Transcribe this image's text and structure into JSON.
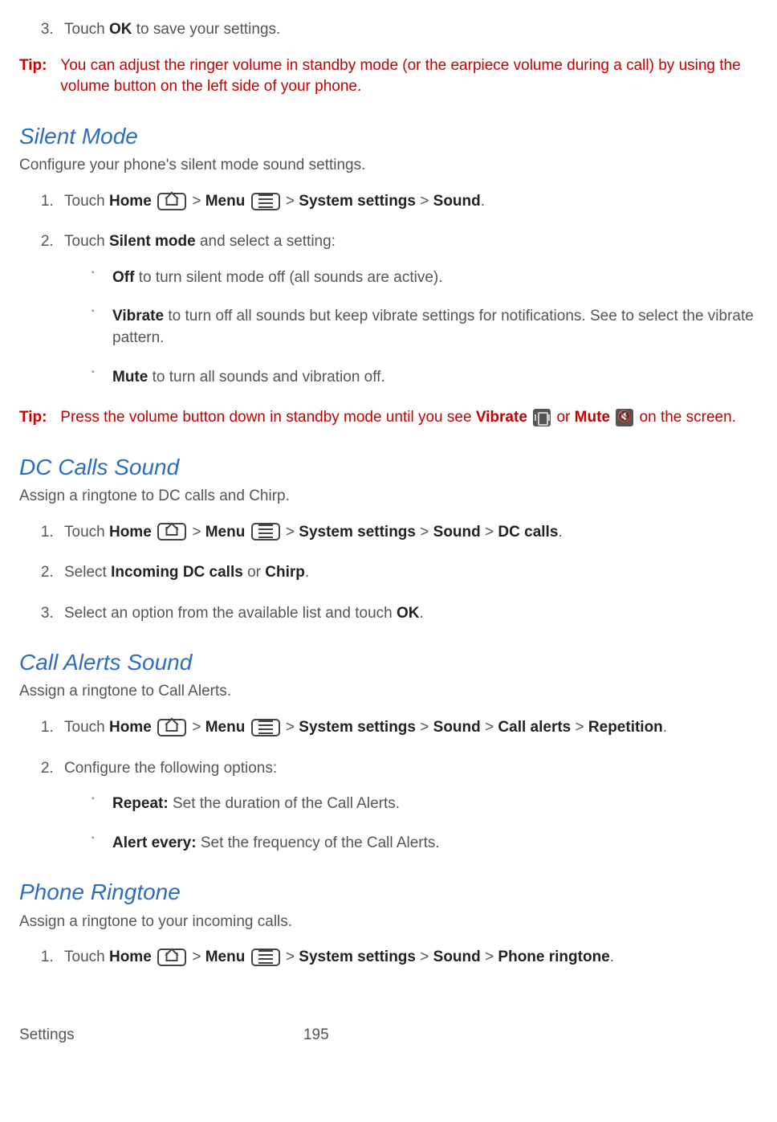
{
  "top_step3": {
    "prefix": "Touch ",
    "bold": "OK",
    "suffix": " to save your settings."
  },
  "tip1": {
    "label": "Tip:",
    "text": "You can adjust the ringer volume in standby mode (or the earpiece volume during a call) by using the volume button on the left side of your phone."
  },
  "silent": {
    "heading": "Silent Mode",
    "lead": "Configure your phone's silent mode sound settings.",
    "step1": {
      "t1": "Touch ",
      "home": "Home",
      "gt1": " > ",
      "menu": "Menu",
      "gt2": " > ",
      "sys": "System settings",
      "gt3": " > ",
      "sound": "Sound",
      "dot": "."
    },
    "step2": {
      "t1": "Touch ",
      "b1": "Silent mode",
      "t2": " and select a setting:"
    },
    "opts": {
      "off": {
        "b": "Off",
        "t": " to turn silent mode off (all sounds are active)."
      },
      "vib": {
        "b": "Vibrate",
        "t": " to turn off all sounds but keep vibrate settings for notifications. See to select the vibrate pattern."
      },
      "mute": {
        "b": "Mute",
        "t": " to turn all sounds and vibration off."
      }
    }
  },
  "tip2": {
    "label": "Tip:",
    "t1": "Press the volume button down in standby mode until you see ",
    "vib": "Vibrate",
    "or": " or ",
    "mute": "Mute",
    "t2": " on the screen."
  },
  "dc": {
    "heading": "DC Calls Sound",
    "lead": "Assign a ringtone to DC calls and Chirp.",
    "step1": {
      "t1": "Touch ",
      "home": "Home",
      "gt1": " > ",
      "menu": "Menu",
      "gt2": " > ",
      "sys": "System settings",
      "gt3": " > ",
      "sound": "Sound",
      "gt4": " > ",
      "dc": "DC calls",
      "dot": "."
    },
    "step2": {
      "t1": "Select ",
      "b1": "Incoming DC calls",
      "or": " or ",
      "b2": "Chirp",
      "dot": "."
    },
    "step3": {
      "t1": "Select an option from the available list and touch ",
      "b1": "OK",
      "dot": "."
    }
  },
  "alerts": {
    "heading": "Call Alerts Sound",
    "lead": "Assign a ringtone to Call Alerts.",
    "step1": {
      "t1": "Touch ",
      "home": "Home",
      "gt1": " > ",
      "menu": "Menu",
      "gt2": " > ",
      "sys": "System settings",
      "gt3": " > ",
      "sound": "Sound",
      "gt4": " > ",
      "ca": "Call alerts",
      "gt5": " > ",
      "rep": "Repetition",
      "dot": "."
    },
    "step2": "Configure the following options:",
    "opts": {
      "repeat": {
        "b": "Repeat:",
        "t": " Set the duration of the Call Alerts."
      },
      "alert": {
        "b": "Alert every:",
        "t": " Set the frequency of the Call Alerts."
      }
    }
  },
  "ringtone": {
    "heading": "Phone Ringtone",
    "lead": "Assign a ringtone to your incoming calls.",
    "step1": {
      "t1": "Touch ",
      "home": "Home",
      "gt1": " > ",
      "menu": "Menu",
      "gt2": " > ",
      "sys": "System settings",
      "gt3": " > ",
      "sound": "Sound",
      "gt4": " > ",
      "pr": "Phone ringtone",
      "dot": "."
    }
  },
  "footer": {
    "section": "Settings",
    "page": "195"
  }
}
